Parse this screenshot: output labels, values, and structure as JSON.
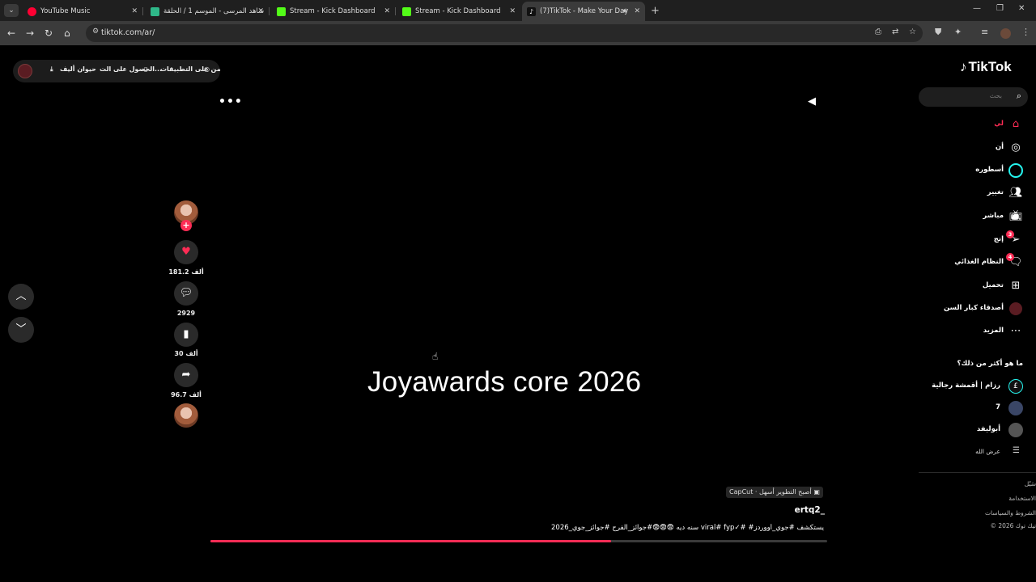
{
  "browser": {
    "tabs": [
      {
        "label": "YouTube Music",
        "favicon_color": "#ff0033",
        "active": false
      },
      {
        "label": "شاهد المرسى - الموسم 1 / الحلقة",
        "favicon_color": "#2fb889",
        "active": false
      },
      {
        "label": "Stream - Kick Dashboard",
        "favicon_color": "#53fc18",
        "active": false
      },
      {
        "label": "Stream - Kick Dashboard",
        "favicon_color": "#53fc18",
        "active": false
      },
      {
        "label": "(7)TikTok - Make Your Day",
        "favicon_color": "#ffffff",
        "active": true
      }
    ],
    "url": "tiktok.com/ar/"
  },
  "top_pill": {
    "get_apps": "من على التطبيقات",
    "get_app": "الحصول على الت...",
    "live_animal": "حيوان أليف"
  },
  "video": {
    "overlay_text": "Joyawards core 2026",
    "capcut_label": "CapCut · أصبح التطوير أسهل",
    "author": "ertq2_",
    "caption": "سنه ديه 😨😨😨#جوائز_الفرح #جوائز_جوي_2026 viral# fyp✓# #يستكشف #جوي_أووردز",
    "progress": 0.65
  },
  "actions": {
    "likes": "181.2 ألف",
    "comments": "2929",
    "saves": "30 ألف",
    "shares": "96.7 ألف"
  },
  "sidebar": {
    "logo": "TikTok",
    "search_placeholder": "بحث",
    "items": [
      {
        "label": "لي",
        "icon": "home-icon",
        "active": true
      },
      {
        "label": "أن",
        "icon": "compass-icon"
      },
      {
        "label": "أسطوره",
        "icon": "live-ring-icon"
      },
      {
        "label": "تغيير",
        "icon": "friends-icon"
      },
      {
        "label": "مباشر",
        "icon": "tv-icon"
      },
      {
        "label": "إتج",
        "icon": "send-icon",
        "badge": "3"
      },
      {
        "label": "النظام الغذائي",
        "icon": "message-icon",
        "badge": "4"
      },
      {
        "label": "تحميل",
        "icon": "upload-icon"
      },
      {
        "label": "أصدقاء كبار السن",
        "icon": "profile-icon"
      },
      {
        "label": "المزيد",
        "icon": "more-icon"
      }
    ],
    "following_title": "ما هو أكثر من ذلك؟",
    "following": [
      {
        "name": "رزام | أقمشة رجالية"
      },
      {
        "name": "7"
      },
      {
        "name": "أبوليفد"
      }
    ],
    "see_all": "عرض الله",
    "footer": [
      "سَيّل",
      "الاستخدامة",
      "الشروط والسياسات",
      "© 2026 تيك توك"
    ]
  }
}
